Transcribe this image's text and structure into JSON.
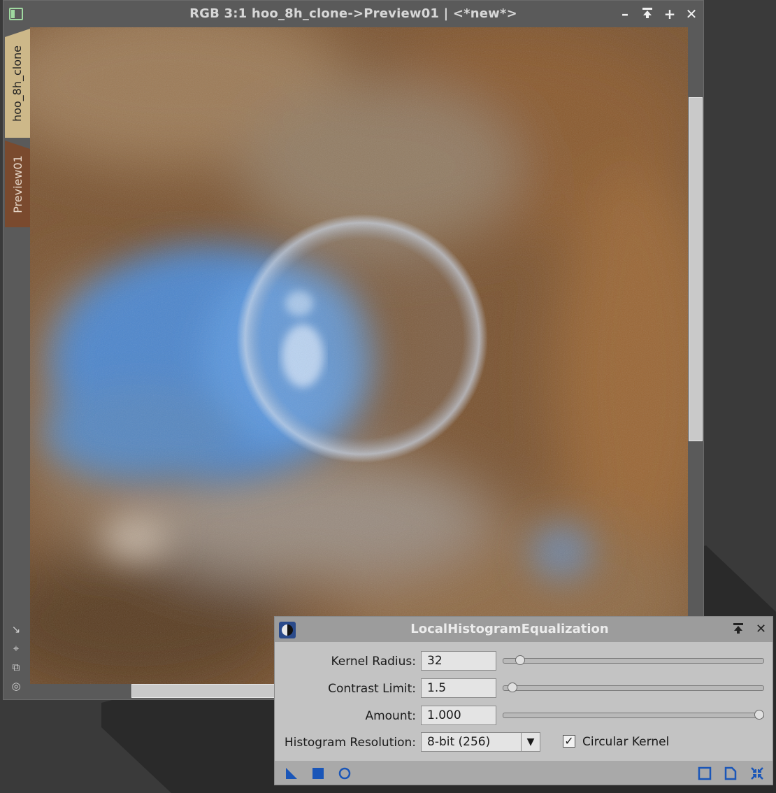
{
  "image_window": {
    "title": "RGB 3:1 hoo_8h_clone->Preview01 | <*new*>",
    "tabs": [
      {
        "label": "hoo_8h_clone"
      },
      {
        "label": "Preview01"
      }
    ],
    "buttons": {
      "minimize_icon": "minimize-icon",
      "shade_icon": "shade-icon",
      "maximize_icon": "maximize-icon",
      "close_icon": "close-icon"
    }
  },
  "dialog": {
    "title": "LocalHistogramEqualization",
    "kernel_radius": {
      "label": "Kernel Radius:",
      "value": "32",
      "fraction": 0.05
    },
    "contrast_limit": {
      "label": "Contrast Limit:",
      "value": "1.5",
      "fraction": 0.02
    },
    "amount": {
      "label": "Amount:",
      "value": "1.000",
      "fraction": 1.0
    },
    "histogram_resolution": {
      "label": "Histogram Resolution:",
      "value": "8-bit (256)"
    },
    "circular_kernel": {
      "label": "Circular Kernel",
      "checked": true
    }
  },
  "colors": {
    "accent_blue": "#1a56b8",
    "tab_main": "#cdb889",
    "tab_preview": "#7a4a2e"
  }
}
